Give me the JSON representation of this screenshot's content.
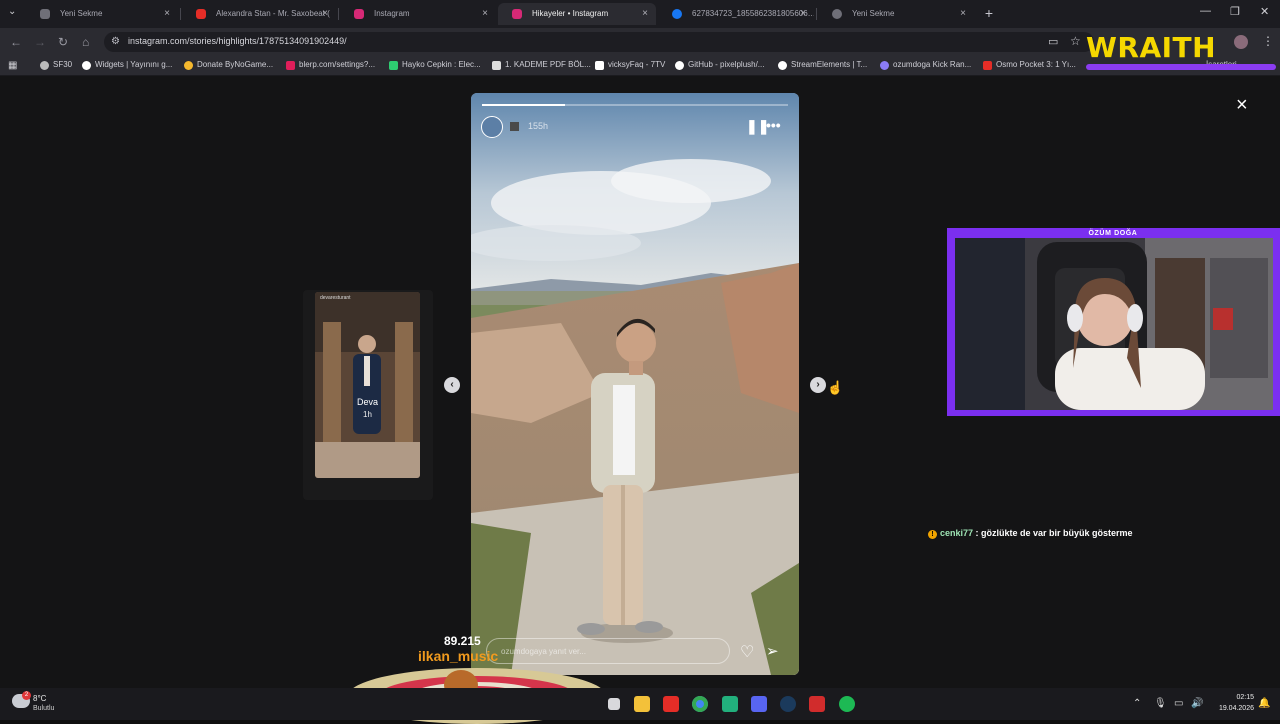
{
  "tabs": [
    {
      "label": "Yeni Sekme",
      "color": "#6f6f78"
    },
    {
      "label": "Alexandra Stan - Mr. Saxobeat (",
      "color": "#e52d27"
    },
    {
      "label": "Instagram",
      "color": "#d62976"
    },
    {
      "label": "Hikayeler • Instagram",
      "color": "#d62976"
    },
    {
      "label": "627834723_1855862381805606…",
      "color": "#1877f2"
    },
    {
      "label": "Yeni Sekme",
      "color": "#6f6f78"
    }
  ],
  "address": {
    "url": "instagram.com/stories/highlights/17875134091902449/"
  },
  "bookmarks": [
    {
      "label": "SF30",
      "color": "#bbbbbb"
    },
    {
      "label": "Widgets | Yayınını g...",
      "color": "#ffffff"
    },
    {
      "label": "Donate ByNoGame...",
      "color": "#f5b82e"
    },
    {
      "label": "blerp.com/settings?...",
      "color": "#e01e5a"
    },
    {
      "label": "Hayko Cepkin : Elec...",
      "color": "#2ecc71"
    },
    {
      "label": "1. KADEME PDF BÖL...",
      "color": "#dddddd"
    },
    {
      "label": "vicksyFaq - 7TV",
      "color": "#ffffff"
    },
    {
      "label": "GitHub - pixelplush/...",
      "color": "#ffffff"
    },
    {
      "label": "StreamElements | T...",
      "color": "#ffffff"
    },
    {
      "label": "ozumdoga Kick Ran...",
      "color": "#8b7cf6"
    },
    {
      "label": "Osmo Pocket 3: 1 Yı...",
      "color": "#e52d27"
    },
    {
      "label": "İşaretleri",
      "color": "#ffcc44"
    }
  ],
  "overlay": {
    "brand": "WRAITH",
    "cam_title": "ÖZÜM DOĞA"
  },
  "story": {
    "time": "155h",
    "progress": 0.27,
    "reply_placeholder": "ozumdogaya yanıt ver..."
  },
  "prev_story": {
    "user": "devaresturant",
    "name": "Deva",
    "time": "1h"
  },
  "chat": {
    "user": "cenki77",
    "message": " : gözlükte de var bir büyük gösterme"
  },
  "alert": {
    "amount": "89.215",
    "user": "ilkan_music"
  },
  "weather": {
    "temp": "8°C",
    "desc": "Bulutlu",
    "badge": "2"
  },
  "clock": {
    "time": "02:15",
    "date": "19.04.2026"
  },
  "icons": {
    "close": "×",
    "pause": "❚❚",
    "more": "•••",
    "heart": "♡",
    "send": "➢",
    "arrow_left": "‹",
    "arrow_right": "›"
  }
}
